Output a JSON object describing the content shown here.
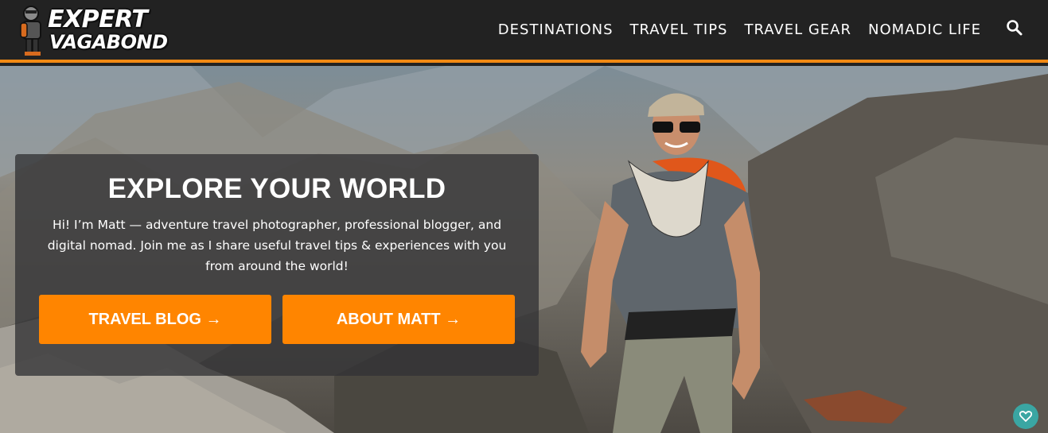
{
  "header": {
    "logo": {
      "line1": "EXPERT",
      "line2": "VAGABOND"
    },
    "nav": [
      {
        "label": "DESTINATIONS"
      },
      {
        "label": "TRAVEL TIPS"
      },
      {
        "label": "TRAVEL GEAR"
      },
      {
        "label": "NOMADIC LIFE"
      }
    ],
    "search_icon": "search-icon",
    "accent_color": "#f28a14"
  },
  "hero": {
    "title": "EXPLORE YOUR WORLD",
    "intro": "Hi! I’m Matt — adventure travel photographer, professional blogger, and digital nomad. Join me as I share useful travel tips & experiences with you from around the world!",
    "buttons": [
      {
        "label": "TRAVEL BLOG →",
        "color": "#ff8500"
      },
      {
        "label": "ABOUT MATT →",
        "color": "#ff8500"
      }
    ]
  },
  "floating": {
    "icon": "heart-icon",
    "color": "#3aa6a3"
  }
}
